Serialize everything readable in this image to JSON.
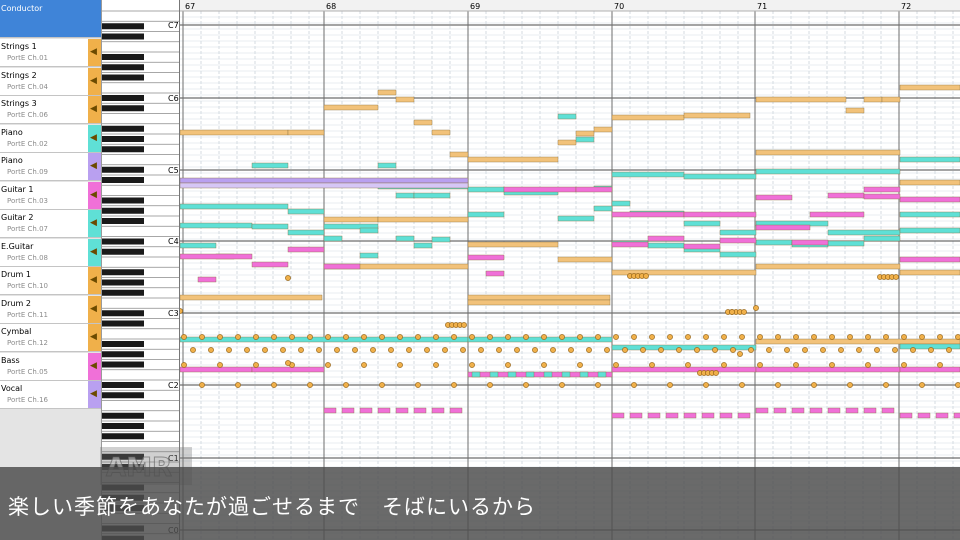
{
  "tracks": [
    {
      "name": "Conductor",
      "port": "",
      "color": "#3f84d8"
    },
    {
      "name": "Strings 1",
      "port": "PortE  Ch.01",
      "color": "#f0b04a"
    },
    {
      "name": "Strings 2",
      "port": "PortE  Ch.04",
      "color": "#f0b04a"
    },
    {
      "name": "Strings 3",
      "port": "PortE  Ch.06",
      "color": "#f0b04a"
    },
    {
      "name": "Piano",
      "port": "PortE  Ch.02",
      "color": "#5fe0d6"
    },
    {
      "name": "Piano",
      "port": "PortE  Ch.09",
      "color": "#b9a0f0"
    },
    {
      "name": "Guitar 1",
      "port": "PortE  Ch.03",
      "color": "#f070d8"
    },
    {
      "name": "Guitar 2",
      "port": "PortE  Ch.07",
      "color": "#5fe0d6"
    },
    {
      "name": "E.Guitar",
      "port": "PortE  Ch.08",
      "color": "#5fe0d6"
    },
    {
      "name": "Drum 1",
      "port": "PortE  Ch.10",
      "color": "#f0b04a"
    },
    {
      "name": "Drum 2",
      "port": "PortE  Ch.11",
      "color": "#f0b04a"
    },
    {
      "name": "Cymbal",
      "port": "PortE  Ch.12",
      "color": "#f0b04a"
    },
    {
      "name": "Bass",
      "port": "PortE  Ch.05",
      "color": "#f070d8"
    },
    {
      "name": "Vocal",
      "port": "PortE  Ch.16",
      "color": "#b9a0f0"
    }
  ],
  "speaker_icon": "speaker-icon",
  "measures": [
    "67",
    "68",
    "69",
    "70",
    "71",
    "72"
  ],
  "octaves": [
    "C7",
    "C6",
    "C5",
    "C4",
    "C3",
    "C2",
    "C1",
    "C0"
  ],
  "caption": "楽しい季節をあなたが過ごせるまで　そばにいるから",
  "logo_text": "AMR",
  "colors": {
    "strings": "#f2c27a",
    "piano": "#5fe0d6",
    "guitar": "#f070d8",
    "vocal": "#b9a0f0",
    "drum": "#f0b04a",
    "conductor": "#3f84d8"
  }
}
